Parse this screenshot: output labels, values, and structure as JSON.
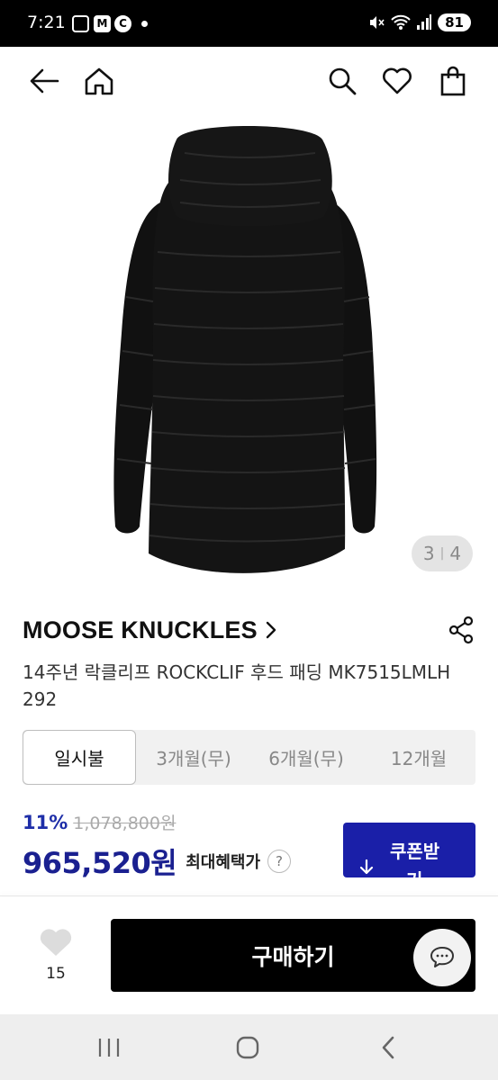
{
  "status_bar": {
    "time": "7:21",
    "app_icon_m": "M",
    "app_icon_c": "C",
    "battery": "81"
  },
  "app_bar": {
    "icons": [
      "back-arrow-icon",
      "home-icon",
      "search-icon",
      "heart-icon",
      "shopping-bag-icon"
    ]
  },
  "gallery": {
    "current": "3",
    "total": "4",
    "image": "black-hooded-puffer-coat-back-view"
  },
  "product": {
    "brand": "MOOSE KNUCKLES",
    "title": "14주년 락클리프 ROCKCLIF 후드 패딩 MK7515LMLH 292"
  },
  "installments": {
    "tabs": [
      "일시불",
      "3개월(무)",
      "6개월(무)",
      "12개월"
    ],
    "selected": "일시불"
  },
  "price": {
    "discount": "11%",
    "original": "1,078,800원",
    "sale": "965,520원",
    "max_benefit_label": "최대혜택가",
    "help": "?"
  },
  "coupon": {
    "label_line1": "쿠폰받",
    "label_line2": "기"
  },
  "bottom_bar": {
    "like_count": "15",
    "buy_label": "구매하기"
  },
  "colors": {
    "accent_blue": "#1a1fa8",
    "price_blue": "#1a2090",
    "buy_black": "#000000"
  }
}
